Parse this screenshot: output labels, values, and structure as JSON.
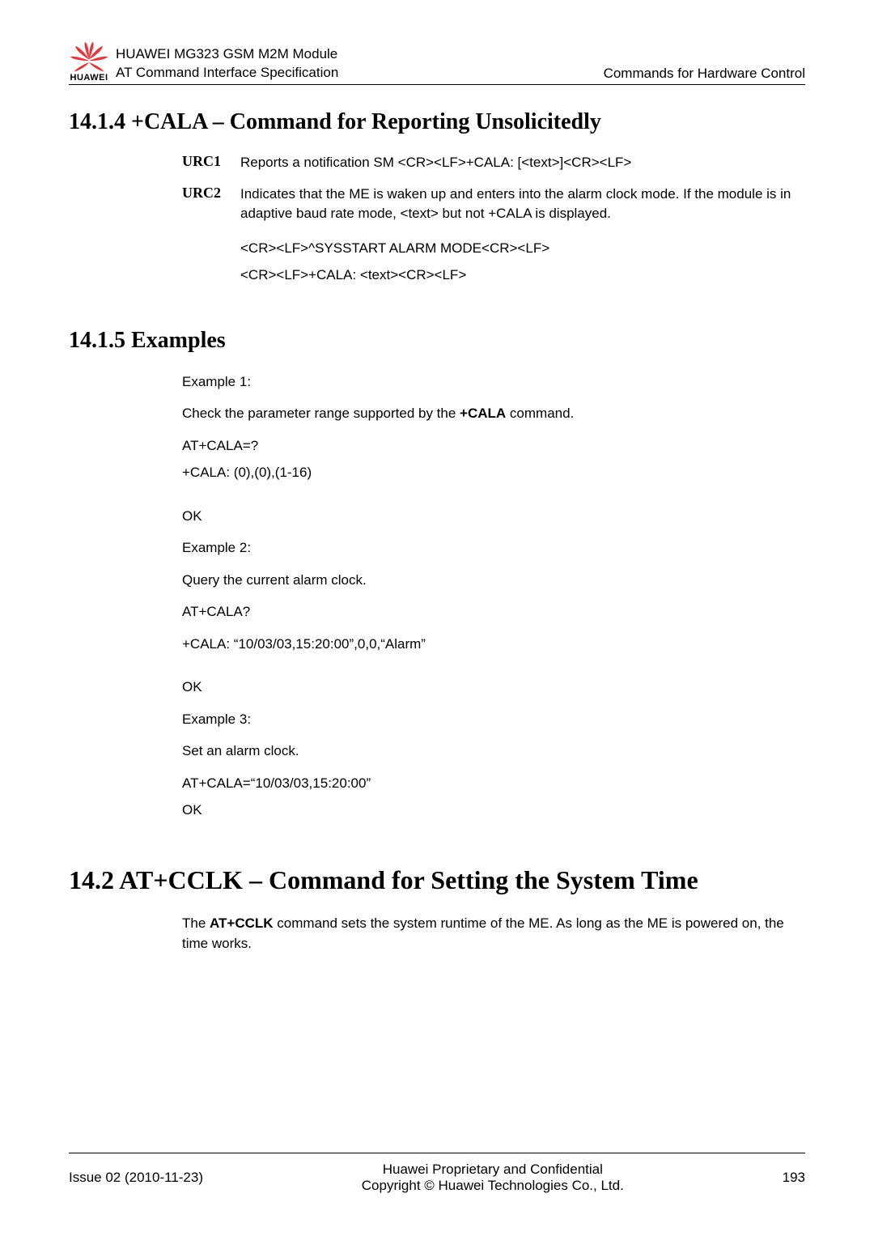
{
  "header": {
    "logoText": "HUAWEI",
    "title1": "HUAWEI MG323 GSM M2M Module",
    "title2": "AT Command Interface Specification",
    "right": "Commands for Hardware Control"
  },
  "s1414": {
    "heading": "14.1.4 +CALA – Command for Reporting Unsolicitedly",
    "urc1Label": "URC1",
    "urc1Body": "Reports a notification SM <CR><LF>+CALA: [<text>]<CR><LF>",
    "urc2Label": "URC2",
    "urc2Body": "Indicates that the ME is waken up and enters into the alarm clock mode. If the module is in adaptive baud rate mode, <text> but not +CALA is displayed.",
    "urc2Line1": "<CR><LF>^SYSSTART ALARM MODE<CR><LF>",
    "urc2Line2": "<CR><LF>+CALA: <text><CR><LF>"
  },
  "s1415": {
    "heading": "14.1.5 Examples",
    "ex1Label": "Example 1:",
    "ex1DescPre": "Check the parameter range supported by the ",
    "ex1DescBold": "+CALA",
    "ex1DescPost": " command.",
    "ex1Cmd1": "AT+CALA=?",
    "ex1Cmd2": "+CALA: (0),(0),(1-16)",
    "ok1": "OK",
    "ex2Label": "Example 2:",
    "ex2Desc": "Query the current alarm clock.",
    "ex2Cmd1": "AT+CALA?",
    "ex2Cmd2": "+CALA: “10/03/03,15:20:00”,0,0,“Alarm”",
    "ok2": "OK",
    "ex3Label": "Example 3:",
    "ex3Desc": "Set an alarm clock.",
    "ex3Cmd1": "AT+CALA=“10/03/03,15:20:00”",
    "ok3": "OK"
  },
  "s142": {
    "heading": "14.2 AT+CCLK – Command for Setting the System Time",
    "bodyPre": "The ",
    "bodyBold": "AT+CCLK",
    "bodyPost": " command sets the system runtime of the ME. As long as the ME is powered on, the time works."
  },
  "footer": {
    "left": "Issue 02 (2010-11-23)",
    "center1": "Huawei Proprietary and Confidential",
    "center2": "Copyright © Huawei Technologies Co., Ltd.",
    "right": "193"
  }
}
